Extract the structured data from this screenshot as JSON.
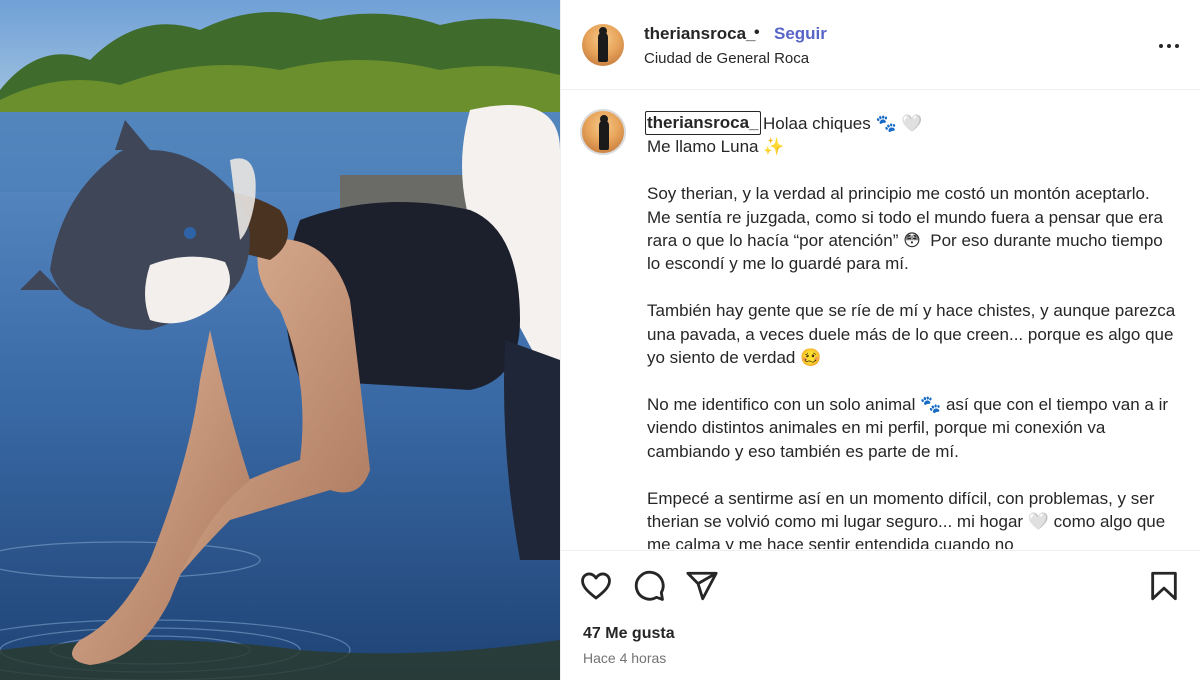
{
  "header": {
    "username": "theriansroca_",
    "separator": "•",
    "follow_label": "Seguir",
    "location": "Ciudad de General Roca"
  },
  "caption": {
    "username": "theriansroca_",
    "text": "Holaa chiques 🐾 🤍\nMe llamo Luna ✨\n\nSoy therian, y la verdad al principio me costó un montón aceptarlo. Me sentía re juzgada, como si todo el mundo fuera a pensar que era rara o que lo hacía “por atención” 😳  Por eso durante mucho tiempo lo escondí y me lo guardé para mí.\n\nTambién hay gente que se ríe de mí y hace chistes, y aunque parezca una pavada, a veces duele más de lo que creen... porque es algo que yo siento de verdad 🥴\n\nNo me identifico con un solo animal 🐾 así que con el tiempo van a ir viendo distintos animales en mi perfil, porque mi conexión va cambiando y eso también es parte de mí.\n\nEmpecé a sentirme así en un momento difícil, con problemas, y ser therian se volvió como mi lugar seguro... mi hogar 🤍 como algo que me calma y me hace sentir entendida cuando no"
  },
  "actions": {
    "icons": [
      "heart-icon",
      "comment-icon",
      "share-icon",
      "bookmark-icon"
    ],
    "likes": "47 Me gusta",
    "time": "Hace 4 horas"
  },
  "colors": {
    "follow": "#5865c8",
    "muted": "#737373",
    "text": "#262626"
  }
}
